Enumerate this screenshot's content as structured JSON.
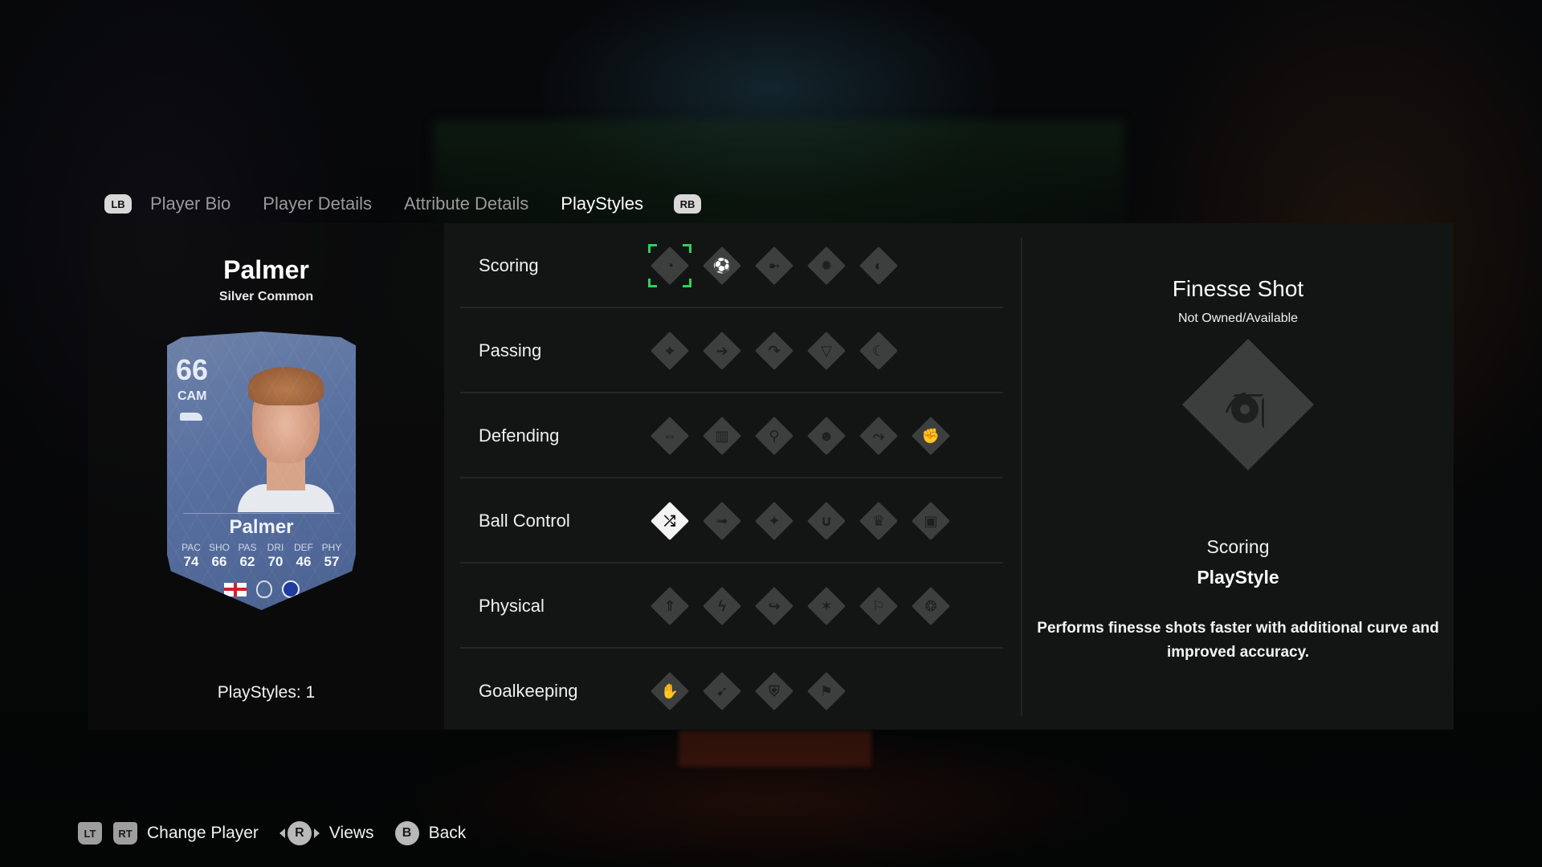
{
  "tabs": {
    "left_bumper": "LB",
    "right_bumper": "RB",
    "items": [
      {
        "label": "Player Bio",
        "active": false
      },
      {
        "label": "Player Details",
        "active": false
      },
      {
        "label": "Attribute Details",
        "active": false
      },
      {
        "label": "PlayStyles",
        "active": true
      }
    ]
  },
  "player": {
    "name": "Palmer",
    "rarity": "Silver Common",
    "playstyles_count_label": "PlayStyles: 1",
    "card": {
      "rating": "66",
      "position": "CAM",
      "name": "Palmer",
      "nation": "England",
      "league": "Premier League",
      "club": "Chelsea",
      "stats": [
        {
          "label": "PAC",
          "value": "74"
        },
        {
          "label": "SHO",
          "value": "66"
        },
        {
          "label": "PAS",
          "value": "62"
        },
        {
          "label": "DRI",
          "value": "70"
        },
        {
          "label": "DEF",
          "value": "46"
        },
        {
          "label": "PHY",
          "value": "57"
        }
      ]
    }
  },
  "categories": [
    {
      "label": "Scoring",
      "icons": [
        {
          "name": "finesse-shot-icon",
          "glyph": "◔",
          "owned": false,
          "selected": true
        },
        {
          "name": "chip-shot-icon",
          "glyph": "⚽",
          "owned": false
        },
        {
          "name": "power-shot-icon",
          "glyph": "➼",
          "owned": false
        },
        {
          "name": "dead-ball-icon",
          "glyph": "✹",
          "owned": false
        },
        {
          "name": "power-header-icon",
          "glyph": "◐",
          "owned": false
        }
      ]
    },
    {
      "label": "Passing",
      "icons": [
        {
          "name": "incisive-pass-icon",
          "glyph": "⌖",
          "owned": false
        },
        {
          "name": "pinged-pass-icon",
          "glyph": "➔",
          "owned": false
        },
        {
          "name": "long-ball-pass-icon",
          "glyph": "↷",
          "owned": false
        },
        {
          "name": "tiki-taka-icon",
          "glyph": "▽",
          "owned": false
        },
        {
          "name": "whipped-pass-icon",
          "glyph": "☾",
          "owned": false
        }
      ]
    },
    {
      "label": "Defending",
      "icons": [
        {
          "name": "jockey-icon",
          "glyph": "⇔",
          "owned": false
        },
        {
          "name": "block-icon",
          "glyph": "▥",
          "owned": false
        },
        {
          "name": "intercept-icon",
          "glyph": "⚲",
          "owned": false
        },
        {
          "name": "anticipate-icon",
          "glyph": "☻",
          "owned": false
        },
        {
          "name": "slide-tackle-icon",
          "glyph": "⤳",
          "owned": false
        },
        {
          "name": "bruiser-icon",
          "glyph": "✊",
          "owned": false
        }
      ]
    },
    {
      "label": "Ball Control",
      "icons": [
        {
          "name": "technical-icon",
          "glyph": "⤮",
          "owned": true
        },
        {
          "name": "rapid-icon",
          "glyph": "➟",
          "owned": false
        },
        {
          "name": "flair-icon",
          "glyph": "✦",
          "owned": false
        },
        {
          "name": "first-touch-icon",
          "glyph": "∪",
          "owned": false
        },
        {
          "name": "trickster-icon",
          "glyph": "♛",
          "owned": false
        },
        {
          "name": "press-proven-icon",
          "glyph": "▣",
          "owned": false
        }
      ]
    },
    {
      "label": "Physical",
      "icons": [
        {
          "name": "quick-step-icon",
          "glyph": "⇑",
          "owned": false
        },
        {
          "name": "relentless-icon",
          "glyph": "ϟ",
          "owned": false
        },
        {
          "name": "trivela-icon",
          "glyph": "↪",
          "owned": false
        },
        {
          "name": "acrobatic-icon",
          "glyph": "✶",
          "owned": false
        },
        {
          "name": "long-throw-icon",
          "glyph": "⚐",
          "owned": false
        },
        {
          "name": "aerial-icon",
          "glyph": "❂",
          "owned": false
        }
      ]
    },
    {
      "label": "Goalkeeping",
      "icons": [
        {
          "name": "far-throw-icon",
          "glyph": "✋",
          "owned": false
        },
        {
          "name": "footwork-icon",
          "glyph": "➹",
          "owned": false
        },
        {
          "name": "cross-claimer-icon",
          "glyph": "⛨",
          "owned": false
        },
        {
          "name": "rush-out-icon",
          "glyph": "⚑",
          "owned": false
        }
      ]
    }
  ],
  "detail": {
    "title": "Finesse Shot",
    "status": "Not Owned/Available",
    "icon": "finesse-shot-icon",
    "category": "Scoring",
    "type": "PlayStyle",
    "description": "Performs finesse shots faster with additional curve and improved accuracy."
  },
  "bottom_bar": {
    "lt": "LT",
    "rt": "RT",
    "change_player": "Change Player",
    "r_stick": "R",
    "views": "Views",
    "b_button": "B",
    "back": "Back"
  },
  "colors": {
    "selection": "#2ed05c",
    "panel": "#131414",
    "icon_unowned": "#3d3e3e",
    "icon_owned": "#f3f3f3",
    "card_blue": "#5870a0"
  }
}
